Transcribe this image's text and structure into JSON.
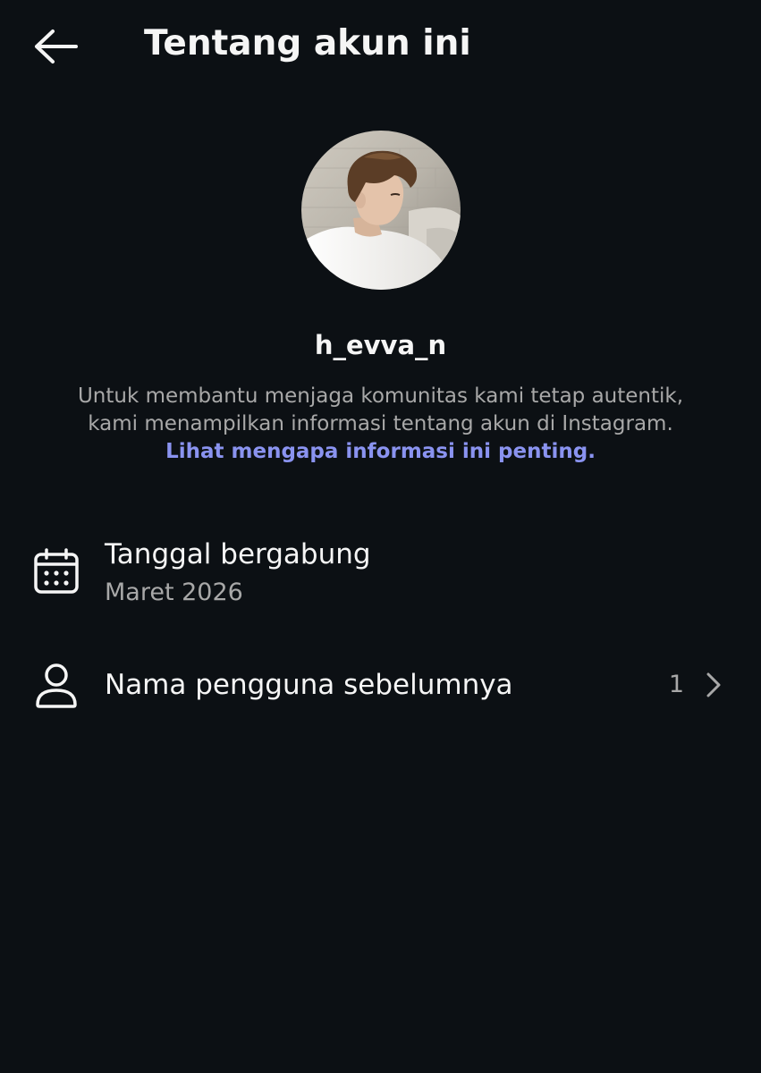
{
  "header": {
    "title": "Tentang akun ini",
    "back_icon": "arrow-left-icon"
  },
  "profile": {
    "avatar_icon": "profile-photo",
    "username": "h_evva_n"
  },
  "description": {
    "line1": "Untuk membantu menjaga komunitas kami tetap autentik,",
    "line2": "kami menampilkan informasi tentang akun di Instagram.",
    "link": "Lihat mengapa informasi ini penting."
  },
  "items": [
    {
      "icon": "calendar-icon",
      "title": "Tanggal bergabung",
      "subtitle": "Maret 2026"
    },
    {
      "icon": "person-icon",
      "title": "Nama pengguna sebelumnya",
      "count": "1",
      "trailing_icon": "chevron-right-icon"
    }
  ],
  "colors": {
    "background": "#0c1014",
    "primary_text": "#f5f5f5",
    "secondary_text": "#a8a8a8",
    "link": "#8a93f0"
  }
}
